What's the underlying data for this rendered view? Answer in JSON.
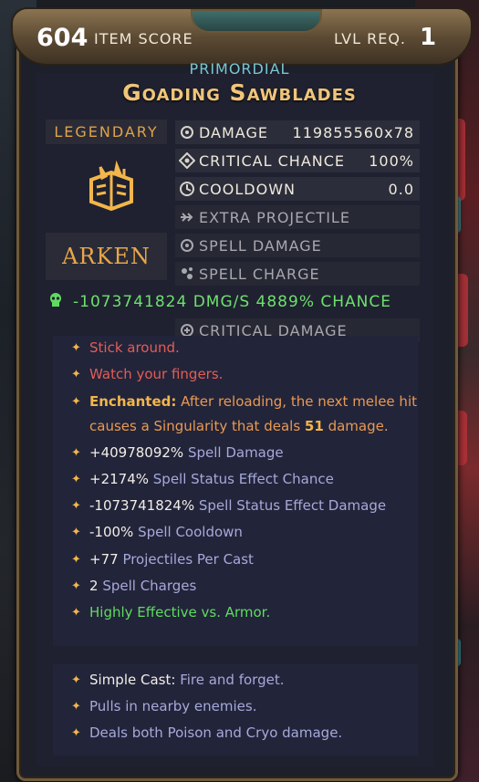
{
  "header": {
    "item_score": "604",
    "item_score_label": "ITEM SCORE",
    "lvl_label": "LVL REQ.",
    "lvl_value": "1"
  },
  "item": {
    "subtitle": "PRIMORDIAL",
    "name": "Goading Sawblades",
    "rarity": "LEGENDARY",
    "brand": "ARKEN"
  },
  "stats": [
    {
      "name": "DAMAGE",
      "value": "119855560x78",
      "icon": "gear-damage-icon"
    },
    {
      "name": "CRITICAL CHANCE",
      "value": "100%",
      "icon": "crit-icon"
    },
    {
      "name": "COOLDOWN",
      "value": "0.0",
      "icon": "cooldown-icon"
    },
    {
      "name": "EXTRA PROJECTILE",
      "value": "",
      "icon": "projectile-icon"
    },
    {
      "name": "SPELL DAMAGE",
      "value": "",
      "icon": "spell-damage-icon"
    },
    {
      "name": "SPELL CHARGE",
      "value": "",
      "icon": "spell-charge-icon"
    },
    {
      "name": "CRITICAL DAMAGE",
      "value": "",
      "icon": "crit-damage-icon"
    }
  ],
  "dps_line": "-1073741824 DMG/S  4889% CHANCE",
  "effects": [
    {
      "label": "",
      "text": "Stick around.",
      "style": "red"
    },
    {
      "label": "",
      "text": "Watch your fingers.",
      "style": "red"
    },
    {
      "label": "Enchanted:",
      "text": "After reloading, the next melee hit causes a Singularity that deals",
      "num": "51",
      "suffix": "damage.",
      "style": "enchant"
    },
    {
      "label": "+40978092%",
      "text": "Spell Damage",
      "style": "stat"
    },
    {
      "label": "+2174%",
      "text": "Spell Status Effect Chance",
      "style": "stat"
    },
    {
      "label": "-1073741824%",
      "text": "Spell Status Effect Damage",
      "style": "stat"
    },
    {
      "label": "-100%",
      "text": "Spell Cooldown",
      "style": "stat"
    },
    {
      "label": "+77",
      "text": "Projectiles Per Cast",
      "style": "stat"
    },
    {
      "label": "2",
      "text": "Spell Charges",
      "style": "stat"
    },
    {
      "label": "",
      "text": "Highly Effective vs. Armor.",
      "style": "green"
    }
  ],
  "passives": [
    {
      "label": "Simple Cast:",
      "text": "Fire and forget."
    },
    {
      "label": "",
      "text": "Pulls in nearby enemies."
    },
    {
      "label": "",
      "text": "Deals both Poison and Cryo damage."
    }
  ],
  "colors": {
    "title_gold": "#f0c57a",
    "subtitle_teal": "#79c6cf",
    "legendary_orange": "#e0a24a",
    "dps_green": "#6ee06e",
    "star_gold": "#f3b64a"
  }
}
